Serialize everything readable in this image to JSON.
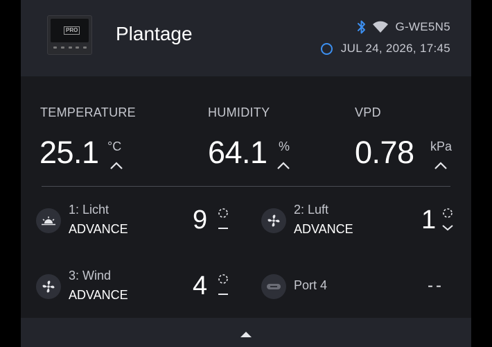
{
  "header": {
    "title": "Plantage",
    "device_badge": "PRO",
    "device_id": "G-WE5N5",
    "datetime": "JUL 24, 2026, 17:45",
    "bluetooth_icon": "bluetooth-icon",
    "wifi_icon": "wifi-icon",
    "accent_color": "#3c8ff0"
  },
  "metrics": [
    {
      "label": "TEMPERATURE",
      "value": "25.1",
      "unit": "°C",
      "trend": "up"
    },
    {
      "label": "HUMIDITY",
      "value": "64.1",
      "unit": "%",
      "trend": "up"
    },
    {
      "label": "VPD",
      "value": "0.78",
      "unit": "kPa",
      "trend": "up"
    }
  ],
  "ports": [
    {
      "name": "1: Licht",
      "mode": "ADVANCE",
      "level": "9",
      "icon": "sun-icon",
      "control": "minus"
    },
    {
      "name": "2: Luft",
      "mode": "ADVANCE",
      "level": "1",
      "icon": "fan-icon",
      "control": "chevron-down"
    },
    {
      "name": "3: Wind",
      "mode": "ADVANCE",
      "level": "4",
      "icon": "fan-icon",
      "control": "minus"
    },
    {
      "name": "Port 4",
      "mode": "",
      "level": "--",
      "icon": "plug-icon",
      "control": "none"
    }
  ],
  "footer": {
    "expand_icon": "chevron-up-icon"
  }
}
